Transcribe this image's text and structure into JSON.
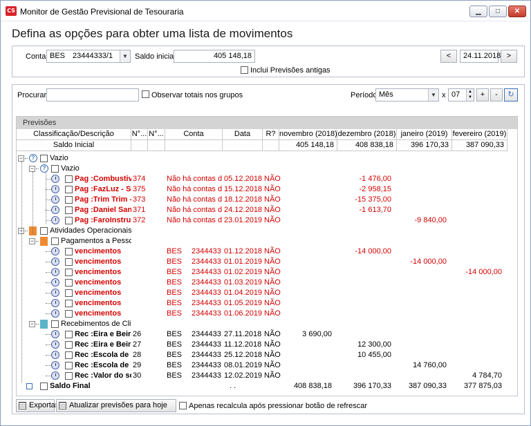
{
  "window": {
    "title": "Monitor de Gestão Previsional de Tesouraria",
    "app_icon": "CS",
    "minimize_icon": "minimize-icon",
    "maximize_icon": "maximize-icon",
    "close_icon": "close-icon"
  },
  "heading": "Defina as opções para obter uma lista de movimentos",
  "account": {
    "conta_label": "Conta",
    "conta_value": "BES",
    "conta_number": "23444333/1",
    "saldo_label": "Saldo inicial",
    "saldo_value": "405 148,18",
    "incluir_label": "Inclui Previsões antigas",
    "date_value": "24.11.2018",
    "prev_label": "<",
    "next_label": ">"
  },
  "filter": {
    "procurar_label": "Procurar :",
    "procurar_value": "",
    "observar_label": "Observar totais nos grupos",
    "periodo_label": "Período",
    "periodo_value": "Mês",
    "x_label": "x",
    "count_value": "07",
    "plus_label": "+",
    "minus_label": "-"
  },
  "grid": {
    "group_title": "Previsões",
    "columns": [
      "Classificação/Descrição",
      "N°...",
      "N°...",
      "Conta",
      "Data",
      "R?",
      "novembro (2018)",
      "dezembro (2018)",
      "janeiro (2019)",
      "fevereiro (2019)"
    ],
    "saldo_inicial": {
      "label": "Saldo Inicial",
      "values": [
        "405 148,18",
        "408 838,18",
        "396 170,33",
        "387 090,33"
      ]
    },
    "groups": [
      {
        "label": "Vazio",
        "sub": "Vazio"
      },
      {
        "label": "Atividades Operacionais",
        "sub1": "Pagamentos a Pessoal",
        "sub2": "Recebimentos de Clie..."
      }
    ],
    "rows": [
      {
        "desc": "Pag :Combustive...",
        "n1": "374",
        "n2": "",
        "conta": "Não há contas d...",
        "data": "05.12.2018",
        "r": "NÃO",
        "nov": "",
        "dez": "-1 476,00",
        "jan": "",
        "fev": "",
        "red": true,
        "ico": "clock",
        "lvl": 2
      },
      {
        "desc": "Pag :FazLuz - Ser...",
        "n1": "375",
        "n2": "",
        "conta": "Não há contas d...",
        "data": "15.12.2018",
        "r": "NÃO",
        "nov": "",
        "dez": "-2 958,15",
        "jan": "",
        "fev": "",
        "red": true,
        "ico": "clock",
        "lvl": 2
      },
      {
        "desc": "Pag :Trim Trim - T...",
        "n1": "373",
        "n2": "",
        "conta": "Não há contas d...",
        "data": "18.12.2018",
        "r": "NÃO",
        "nov": "",
        "dez": "-15 375,00",
        "jan": "",
        "fev": "",
        "red": true,
        "ico": "clock",
        "lvl": 2
      },
      {
        "desc": "Pag :Daniel Sant...",
        "n1": "371",
        "n2": "",
        "conta": "Não há contas d...",
        "data": "24.12.2018",
        "r": "NÃO",
        "nov": "",
        "dez": "-1 613,70",
        "jan": "",
        "fev": "",
        "red": true,
        "ico": "clock",
        "lvl": 2
      },
      {
        "desc": "Pag :FaroInstrum...",
        "n1": "372",
        "n2": "",
        "conta": "Não há contas d...",
        "data": "23.01.2019",
        "r": "NÃO",
        "nov": "",
        "dez": "",
        "jan": "-9 840,00",
        "fev": "",
        "red": true,
        "ico": "clock",
        "lvl": 2
      },
      {
        "desc": "vencimentos",
        "n1": "",
        "n2": "",
        "conta": "BES",
        "conta2": "2344433...",
        "data": "01.12.2018",
        "r": "NÃO",
        "nov": "",
        "dez": "-14 000,00",
        "jan": "",
        "fev": "",
        "red": true,
        "ico": "clock",
        "lvl": 2
      },
      {
        "desc": "vencimentos",
        "n1": "",
        "n2": "",
        "conta": "BES",
        "conta2": "2344433...",
        "data": "01.01.2019",
        "r": "NÃO",
        "nov": "",
        "dez": "",
        "jan": "-14 000,00",
        "fev": "",
        "red": true,
        "ico": "clock",
        "lvl": 2
      },
      {
        "desc": "vencimentos",
        "n1": "",
        "n2": "",
        "conta": "BES",
        "conta2": "2344433...",
        "data": "01.02.2019",
        "r": "NÃO",
        "nov": "",
        "dez": "",
        "jan": "",
        "fev": "-14 000,00",
        "red": true,
        "ico": "clock",
        "lvl": 2
      },
      {
        "desc": "vencimentos",
        "n1": "",
        "n2": "",
        "conta": "BES",
        "conta2": "2344433...",
        "data": "01.03.2019",
        "r": "NÃO",
        "nov": "",
        "dez": "",
        "jan": "",
        "fev": "",
        "red": true,
        "ico": "clock",
        "lvl": 2
      },
      {
        "desc": "vencimentos",
        "n1": "",
        "n2": "",
        "conta": "BES",
        "conta2": "2344433...",
        "data": "01.04.2019",
        "r": "NÃO",
        "nov": "",
        "dez": "",
        "jan": "",
        "fev": "",
        "red": true,
        "ico": "clock",
        "lvl": 2
      },
      {
        "desc": "vencimentos",
        "n1": "",
        "n2": "",
        "conta": "BES",
        "conta2": "2344433...",
        "data": "01.05.2019",
        "r": "NÃO",
        "nov": "",
        "dez": "",
        "jan": "",
        "fev": "",
        "red": true,
        "ico": "clock",
        "lvl": 2
      },
      {
        "desc": "vencimentos",
        "n1": "",
        "n2": "",
        "conta": "BES",
        "conta2": "2344433...",
        "data": "01.06.2019",
        "r": "NÃO",
        "nov": "",
        "dez": "",
        "jan": "",
        "fev": "",
        "red": true,
        "ico": "clock",
        "lvl": 2
      },
      {
        "desc": "Rec :Eira e Beira, ...",
        "n1": "26",
        "n2": "",
        "conta": "BES",
        "conta2": "2344433...",
        "data": "27.11.2018",
        "r": "NÃO",
        "nov": "3 690,00",
        "dez": "",
        "jan": "",
        "fev": "",
        "red": false,
        "ico": "clock",
        "lvl": 2
      },
      {
        "desc": "Rec :Eira e Beira, ...",
        "n1": "27",
        "n2": "",
        "conta": "BES",
        "conta2": "2344433...",
        "data": "11.12.2018",
        "r": "NÃO",
        "nov": "",
        "dez": "12 300,00",
        "jan": "",
        "fev": "",
        "red": false,
        "ico": "clock",
        "lvl": 2
      },
      {
        "desc": "Rec :Escola de M...",
        "n1": "28",
        "n2": "",
        "conta": "BES",
        "conta2": "2344433...",
        "data": "25.12.2018",
        "r": "NÃO",
        "nov": "",
        "dez": "10 455,00",
        "jan": "",
        "fev": "",
        "red": false,
        "ico": "clock",
        "lvl": 2
      },
      {
        "desc": "Rec :Escola de M...",
        "n1": "29",
        "n2": "",
        "conta": "BES",
        "conta2": "2344433...",
        "data": "08.01.2019",
        "r": "NÃO",
        "nov": "",
        "dez": "",
        "jan": "14 760,00",
        "fev": "",
        "red": false,
        "ico": "clock",
        "lvl": 2
      },
      {
        "desc": "Rec :Valor do so...",
        "n1": "30",
        "n2": "",
        "conta": "BES",
        "conta2": "2344433...",
        "data": "12.02.2019",
        "r": "NÃO",
        "nov": "",
        "dez": "",
        "jan": "",
        "fev": "4 784,70",
        "red": false,
        "ico": "clock",
        "lvl": 2
      }
    ],
    "saldo_final": {
      "label": "Saldo Final",
      "data": ". .",
      "values": [
        "408 838,18",
        "396 170,33",
        "387 090,33",
        "377 875,03"
      ]
    }
  },
  "bottom": {
    "exportar_label": "Exportar",
    "atualizar_label": "Atualizar previsões para hoje",
    "apenas_label": "Apenas recalcula após pressionar botão de refrescar"
  },
  "colors": {
    "negative": "#d40000",
    "accent": "#3a6fb8",
    "orange": "#f08a30",
    "teal": "#5ab4c8"
  }
}
